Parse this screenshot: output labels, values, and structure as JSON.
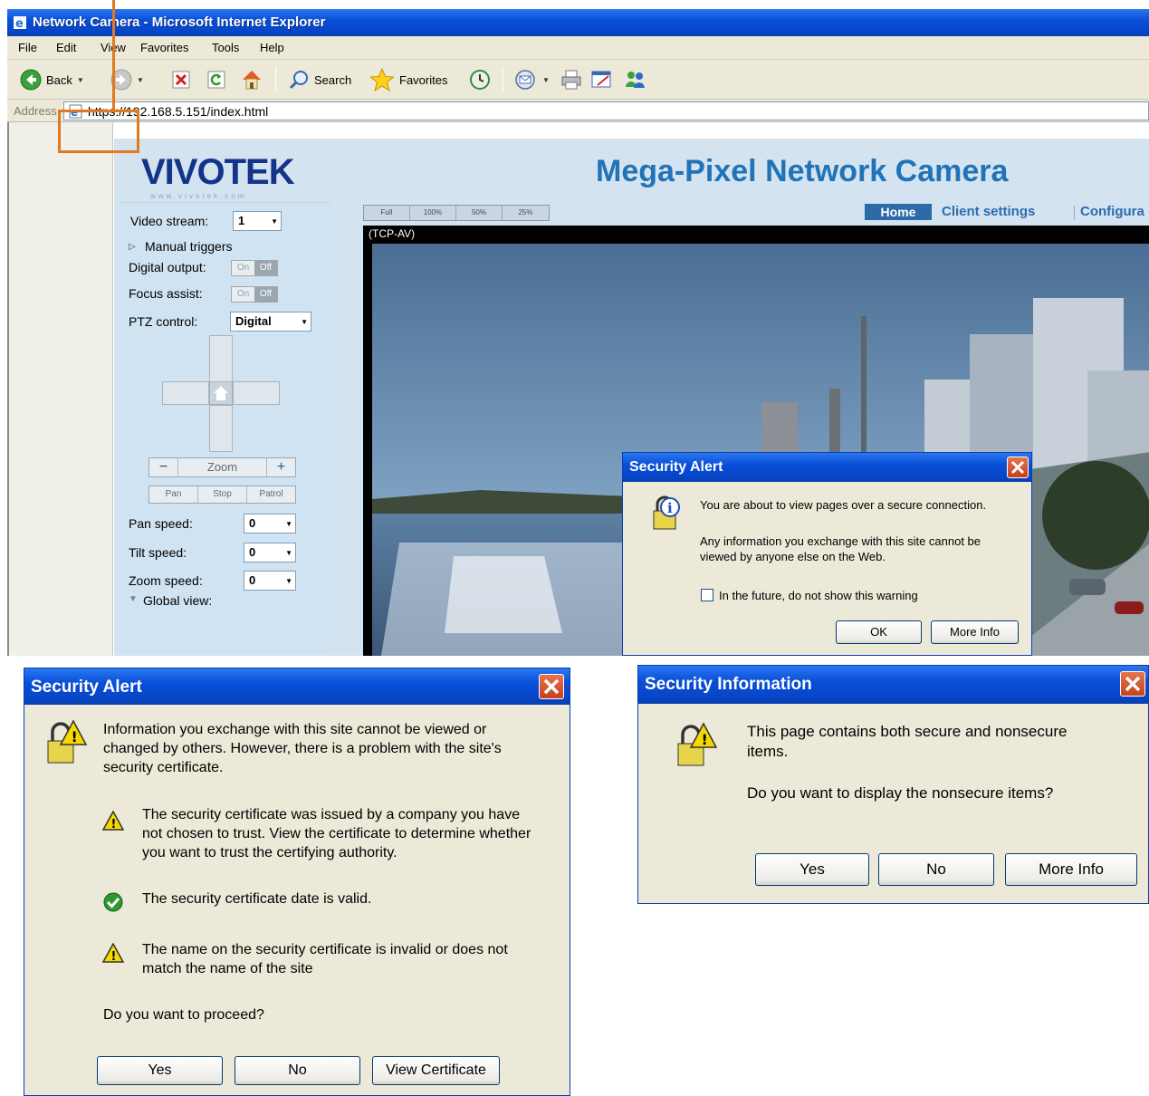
{
  "browser": {
    "title": "Network Camera - Microsoft Internet Explorer",
    "menu": [
      "File",
      "Edit",
      "View",
      "Favorites",
      "Tools",
      "Help"
    ],
    "toolbar": {
      "back": "Back",
      "search": "Search",
      "favorites": "Favorites"
    },
    "address": {
      "label": "Address",
      "url": "https://192.168.5.151/index.html"
    }
  },
  "page": {
    "logo": "VIVOTEK",
    "logo_url": "www.vivotek.com",
    "title": "Mega-Pixel Network Camera",
    "mode_tabs": [
      "Full",
      "100%",
      "50%",
      "25%"
    ],
    "nav": {
      "home": "Home",
      "client_settings": "Client settings",
      "configuration": "Configura"
    },
    "video_label": "(TCP-AV)",
    "sidebar": {
      "video_stream_label": "Video stream:",
      "video_stream_value": "1",
      "manual_triggers": "Manual triggers",
      "digital_output": "Digital output:",
      "focus_assist": "Focus assist:",
      "on": "On",
      "off": "Off",
      "ptz_control": "PTZ control:",
      "ptz_value": "Digital",
      "zoom": "Zoom",
      "pan": "Pan",
      "stop": "Stop",
      "patrol": "Patrol",
      "pan_speed": "Pan speed:",
      "pan_speed_value": "0",
      "tilt_speed": "Tilt speed:",
      "tilt_speed_value": "0",
      "zoom_speed": "Zoom speed:",
      "zoom_speed_value": "0",
      "global_view": "Global view:"
    }
  },
  "dialog_alert_small": {
    "title": "Security Alert",
    "line1": "You are about to view pages over a secure connection.",
    "line2a": "Any information you exchange with this site cannot be",
    "line2b": "viewed by anyone else on the Web.",
    "checkbox": "In the future, do not show this warning",
    "ok": "OK",
    "more_info": "More Info"
  },
  "dialog_alert_cert": {
    "title": "Security Alert",
    "intro_a": "Information you exchange with this site cannot be viewed or",
    "intro_b": "changed by others. However, there is a problem with the site's",
    "intro_c": "security certificate.",
    "item1_a": "The security certificate was issued by a company you have",
    "item1_b": "not chosen to trust. View the certificate to determine whether",
    "item1_c": "you want to trust the certifying authority.",
    "item2": "The security certificate date is valid.",
    "item3_a": "The name on the security certificate is invalid or does not",
    "item3_b": "match the name of the site",
    "question": "Do you want to proceed?",
    "yes": "Yes",
    "no": "No",
    "view_cert": "View Certificate"
  },
  "dialog_info": {
    "title": "Security Information",
    "line1a": "This page contains both secure and nonsecure",
    "line1b": "items.",
    "question": "Do you want to display the nonsecure items?",
    "yes": "Yes",
    "no": "No",
    "more_info": "More Info"
  },
  "colors": {
    "callout": "#e07a1c",
    "xp_title_blue": "#0a4fd8",
    "vivotek_blue": "#14348a",
    "warning_yellow": "#f5d800",
    "valid_green": "#2e9a2e"
  }
}
